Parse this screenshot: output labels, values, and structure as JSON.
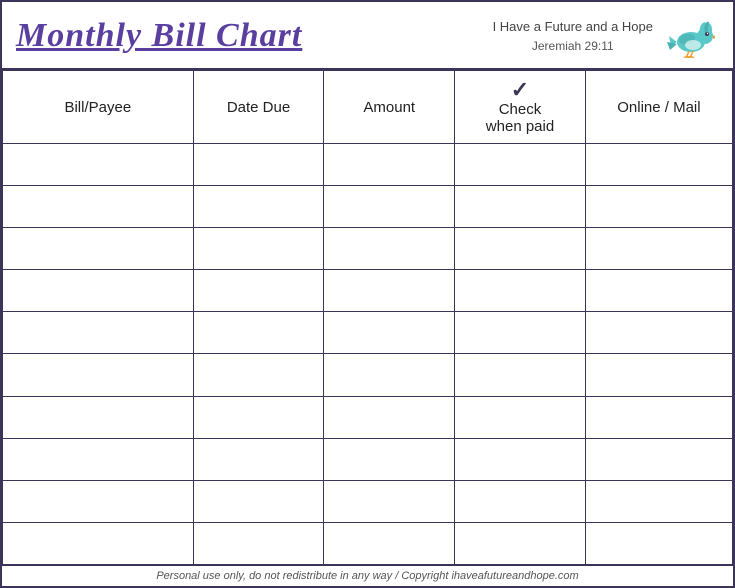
{
  "header": {
    "title": "Monthly Bill Chart",
    "tagline": "I Have a Future and a Hope",
    "verse": "Jeremiah 29:11"
  },
  "columns": [
    {
      "id": "bill",
      "label": "Bill/Payee"
    },
    {
      "id": "date",
      "label": "Date Due"
    },
    {
      "id": "amount",
      "label": "Amount"
    },
    {
      "id": "check",
      "label": "Check when paid",
      "checkmark": "✓"
    },
    {
      "id": "online",
      "label": "Online / Mail"
    }
  ],
  "rows": 10,
  "footer": "Personal use only, do not redistribute in any way / Copyright ihaveafutureandhope.com"
}
